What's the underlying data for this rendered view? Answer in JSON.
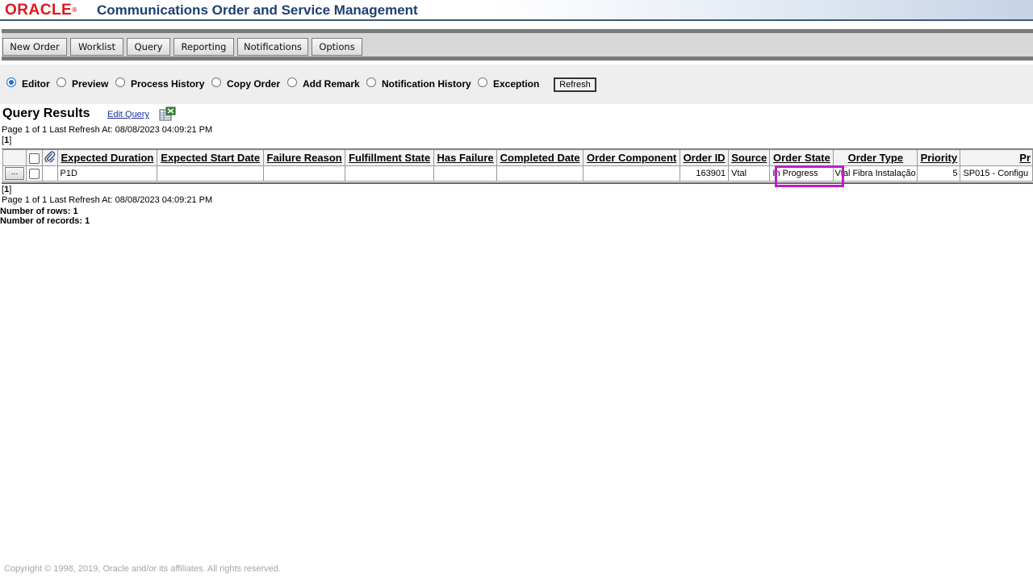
{
  "header": {
    "logo": "ORACLE",
    "logo_mark": "®",
    "title": "Communications Order and Service Management"
  },
  "toolbar": {
    "buttons": [
      "New Order",
      "Worklist",
      "Query",
      "Reporting",
      "Notifications",
      "Options"
    ]
  },
  "view_options": {
    "items": [
      {
        "label": "Editor",
        "checked": true
      },
      {
        "label": "Preview",
        "checked": false
      },
      {
        "label": "Process History",
        "checked": false
      },
      {
        "label": "Copy Order",
        "checked": false
      },
      {
        "label": "Add Remark",
        "checked": false
      },
      {
        "label": "Notification History",
        "checked": false
      },
      {
        "label": "Exception",
        "checked": false
      }
    ],
    "refresh_label": "Refresh"
  },
  "results": {
    "title": "Query Results",
    "edit_query_label": "Edit Query",
    "export_icon": "export-to-spreadsheet-icon",
    "page_info_top": "Page 1 of 1  Last Refresh At: 08/08/2023 04:09:21 PM",
    "pager_top": "1",
    "pager_bottom": "1",
    "page_info_bottom": "Page 1 of 1  Last Refresh At: 08/08/2023 04:09:21 PM",
    "rows_label": "Number of rows: 1",
    "records_label": "Number of records: 1"
  },
  "table": {
    "columns": [
      "Expected Duration",
      "Expected Start Date",
      "Failure Reason",
      "Fulfillment State",
      "Has Failure",
      "Completed Date",
      "Order Component",
      "Order ID",
      "Source",
      "Order State",
      "Order Type",
      "Priority",
      "Pr"
    ],
    "rows": [
      {
        "expected_duration": "P1D",
        "expected_start_date": "",
        "failure_reason": "",
        "fulfillment_state": "",
        "has_failure": "",
        "completed_date": "",
        "order_component": "",
        "order_id": "163901",
        "source": "Vtal",
        "order_state": "In Progress",
        "order_type": "Vtal Fibra Instalação",
        "priority": "5",
        "process": "SP015 - Configu"
      }
    ],
    "row_action_label": "..."
  },
  "footer": {
    "copyright": "Copyright © 1998, 2019, Oracle and/or its affiliates. All rights reserved."
  },
  "colors": {
    "brand_red": "#e0161e",
    "title_blue": "#1e3f74",
    "highlight": "#c01cc8"
  }
}
